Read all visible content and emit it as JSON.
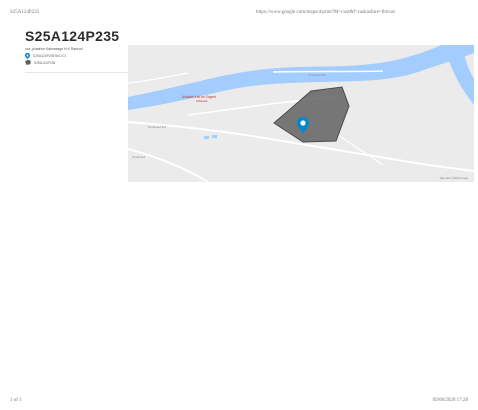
{
  "header": {
    "doc_id": "S25A124P235",
    "url": "https://www.google.com/maps/d/print?M=cust&f=caskasfure=tblcust"
  },
  "page_title": "S25A124P235",
  "legend": {
    "layer_name": "ucs_pinatrive Kabnasage H-K Rancod",
    "items": [
      {
        "icon": "marker-pin-icon",
        "text": "S25A124P235 BnD 01"
      },
      {
        "icon": "polygon-area-icon",
        "text": "S25A124P235"
      }
    ]
  },
  "map": {
    "labels": {
      "place": "Ahadabi Kob an Dogerd",
      "place_sub": "Tafanadi",
      "road_right": "Unnamed Rd",
      "road_mid": "Unnamed Rd",
      "road_left": "Unnamed"
    },
    "footer": "Map data ©2020 Google",
    "colors": {
      "water": "#a3ccff",
      "land": "#ebebeb",
      "polygon": "#616161",
      "pin": "#0288d1"
    }
  },
  "footer": {
    "page": "1 of 1",
    "date": "09/08/2020 17:28"
  }
}
